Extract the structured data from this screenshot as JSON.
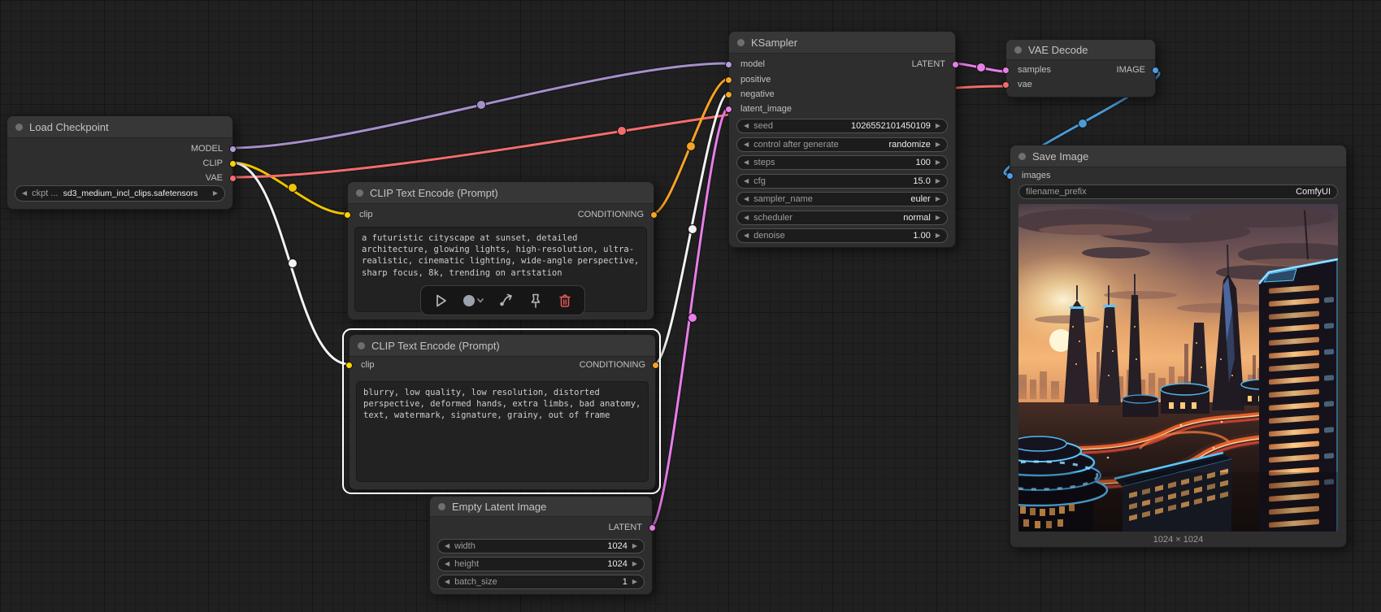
{
  "app": "ComfyUI node graph",
  "colors": {
    "model": "#b39ddb",
    "clip": "#ffd500",
    "vae": "#f26d6d",
    "conditioning": "#f7a325",
    "latent": "#e87ee8",
    "image": "#4d9ee8",
    "selected_link": "#f2f2f2",
    "trash_icon": "#e05858"
  },
  "nodes": {
    "load_checkpoint": {
      "title": "Load Checkpoint",
      "outputs": [
        "MODEL",
        "CLIP",
        "VAE"
      ],
      "widget": {
        "label": "ckpt ...",
        "value": "sd3_medium_incl_clips.safetensors"
      }
    },
    "clip_encode_positive": {
      "title": "CLIP Text Encode (Prompt)",
      "input": "clip",
      "output": "CONDITIONING",
      "prompt": "a futuristic cityscape at sunset, detailed architecture, glowing lights, high-resolution, ultra-realistic, cinematic lighting, wide-angle perspective, sharp focus, 8k, trending on artstation"
    },
    "clip_encode_negative": {
      "title": "CLIP Text Encode (Prompt)",
      "input": "clip",
      "output": "CONDITIONING",
      "prompt": "blurry, low quality, low resolution, distorted perspective, deformed hands, extra limbs, bad anatomy, text, watermark, signature, grainy, out of frame",
      "selected": true
    },
    "empty_latent_image": {
      "title": "Empty Latent Image",
      "output": "LATENT",
      "widgets": [
        {
          "label": "width",
          "value": "1024"
        },
        {
          "label": "height",
          "value": "1024"
        },
        {
          "label": "batch_size",
          "value": "1"
        }
      ]
    },
    "ksampler": {
      "title": "KSampler",
      "inputs": [
        "model",
        "positive",
        "negative",
        "latent_image"
      ],
      "output": "LATENT",
      "widgets": [
        {
          "label": "seed",
          "value": "1026552101450109"
        },
        {
          "label": "control after generate",
          "value": "randomize"
        },
        {
          "label": "steps",
          "value": "100"
        },
        {
          "label": "cfg",
          "value": "15.0"
        },
        {
          "label": "sampler_name",
          "value": "euler"
        },
        {
          "label": "scheduler",
          "value": "normal"
        },
        {
          "label": "denoise",
          "value": "1.00"
        }
      ]
    },
    "vae_decode": {
      "title": "VAE Decode",
      "inputs": [
        "samples",
        "vae"
      ],
      "output": "IMAGE"
    },
    "save_image": {
      "title": "Save Image",
      "input": "images",
      "widget": {
        "label": "filename_prefix",
        "value": "ComfyUI"
      },
      "image_alt": "futuristic cityscape at sunset with glowing lights",
      "resolution": "1024 × 1024"
    }
  },
  "toolbar": {
    "icons": [
      "run",
      "color",
      "bypass",
      "pin",
      "delete"
    ]
  }
}
